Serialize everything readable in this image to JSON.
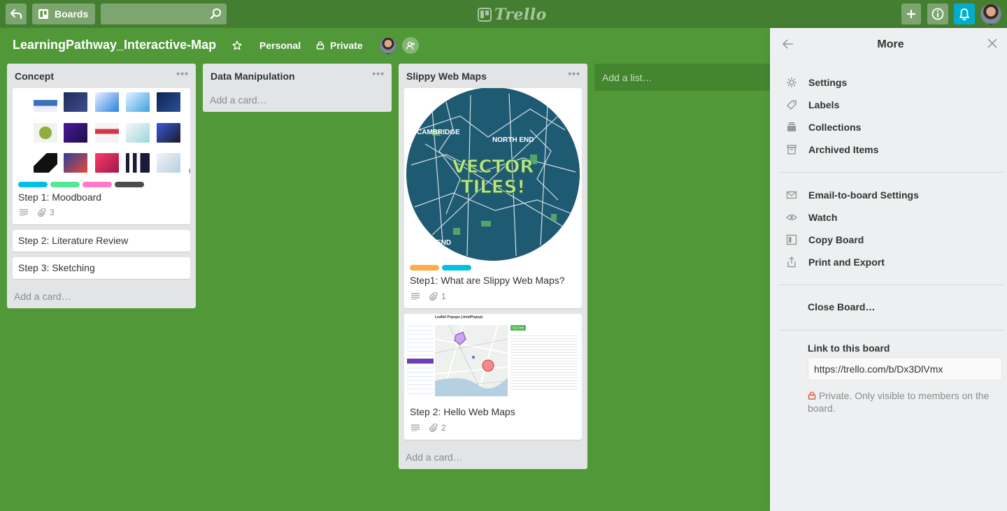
{
  "header": {
    "boards_label": "Boards",
    "search_placeholder": "",
    "logo_text": "Trello"
  },
  "board": {
    "title": "LearningPathway_Interactive-Map",
    "team": "Personal",
    "visibility": "Private"
  },
  "lists": [
    {
      "name": "Concept",
      "cards": [
        {
          "title": "Step 1: Moodboard",
          "attachments": "3",
          "labels": [
            "#00c2e0",
            "#51e898",
            "#ff78cb",
            "#4d4d4d"
          ]
        },
        {
          "title": "Step 2: Literature Review"
        },
        {
          "title": "Step 3: Sketching"
        }
      ],
      "add_card": "Add a card…"
    },
    {
      "name": "Data Manipulation",
      "cards": [],
      "add_card": "Add a card…"
    },
    {
      "name": "Slippy Web Maps",
      "cards": [
        {
          "title": "Step1: What are Slippy Web Maps?",
          "attachments": "1",
          "labels": [
            "#ffab4a",
            "#00c2e0"
          ],
          "cover_text": [
            "VECTOR",
            "TILES!"
          ],
          "cover_places": [
            "CAMBRIDGE",
            "NORTH END",
            "END"
          ]
        },
        {
          "title": "Step 2: Hello Web Maps",
          "attachments": "2",
          "cover_heading": "Leaflet Popups (.bindPopup)",
          "cover_button": "Try Code"
        }
      ],
      "add_card": "Add a card…"
    }
  ],
  "add_list_label": "Add a list…",
  "sidebar": {
    "title": "More",
    "group1": [
      {
        "icon": "gear-icon",
        "label": "Settings"
      },
      {
        "icon": "tag-icon",
        "label": "Labels"
      },
      {
        "icon": "collections-icon",
        "label": "Collections"
      },
      {
        "icon": "archive-icon",
        "label": "Archived Items"
      }
    ],
    "group2": [
      {
        "icon": "email-icon",
        "label": "Email-to-board Settings"
      },
      {
        "icon": "eye-icon",
        "label": "Watch"
      },
      {
        "icon": "copy-board-icon",
        "label": "Copy Board"
      },
      {
        "icon": "share-icon",
        "label": "Print and Export"
      }
    ],
    "close_board": "Close Board…",
    "link_label": "Link to this board",
    "link_url": "https://trello.com/b/Dx3DlVmx",
    "private_note": "Private. Only visible to members on the board."
  },
  "colors": {
    "background": "#519839",
    "header": "#447f31",
    "notification": "#00aecc"
  }
}
